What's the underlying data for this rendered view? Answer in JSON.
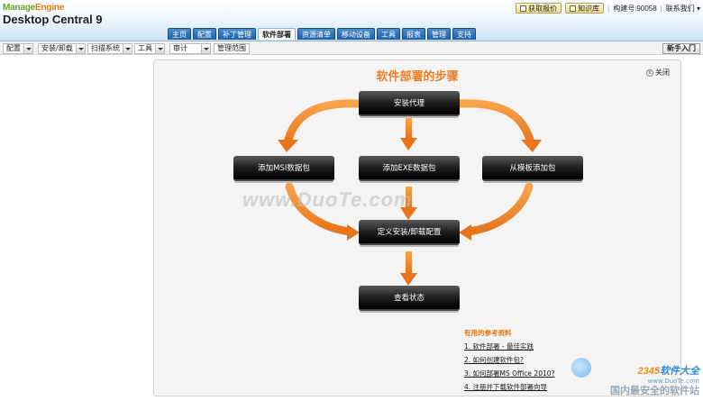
{
  "app": {
    "logo_line1_part1": "Manage",
    "logo_line1_part2": "Engine",
    "logo_line2": "Desktop Central 9"
  },
  "topbar": {
    "quote_button": "获取报价",
    "kb_button": "知识库",
    "build_label": "构建号:90058",
    "contact_label": "联系我们",
    "separator": "|"
  },
  "tabs": [
    {
      "label": "主页"
    },
    {
      "label": "配置"
    },
    {
      "label": "补丁管理"
    },
    {
      "label": "软件部署",
      "active": true
    },
    {
      "label": "资源清单"
    },
    {
      "label": "移动设备"
    },
    {
      "label": "工具"
    },
    {
      "label": "报表"
    },
    {
      "label": "管理"
    },
    {
      "label": "支持"
    }
  ],
  "subnav": {
    "config": "配置",
    "install_uninstall": "安装/卸载",
    "scan_system": "扫描系统",
    "tools": "工具",
    "audit": "审计",
    "manage_scope": "管理范围",
    "quick_start": "新手入门"
  },
  "panel": {
    "title": "软件部署的步骤",
    "close_label": "关闭",
    "close_glyph": "x"
  },
  "steps": {
    "install_agent": "安装代理",
    "add_msi": "添加MSI数据包",
    "add_exe": "添加EXE数据包",
    "add_template": "从模板添加包",
    "define_config": "定义安装/卸载配置",
    "view_status": "查看状态"
  },
  "watermark": "www.DuoTe.com",
  "references": {
    "title": "有用的参考资料",
    "items": [
      "1. 软件部署 - 最佳实践",
      "2. 如何创建软件包?",
      "3. 如何部署MS Office 2010?",
      "4. 注册并下载软件部署向导"
    ]
  },
  "brand": {
    "name_part1": "2345",
    "name_part2": "软件大全",
    "url": "www.DuoTe.com",
    "slogan": "国内最安全的软件站"
  },
  "colors": {
    "accent_orange": "#ef7d22",
    "tab_blue": "#1f5fa6",
    "step_black": "#000000"
  }
}
